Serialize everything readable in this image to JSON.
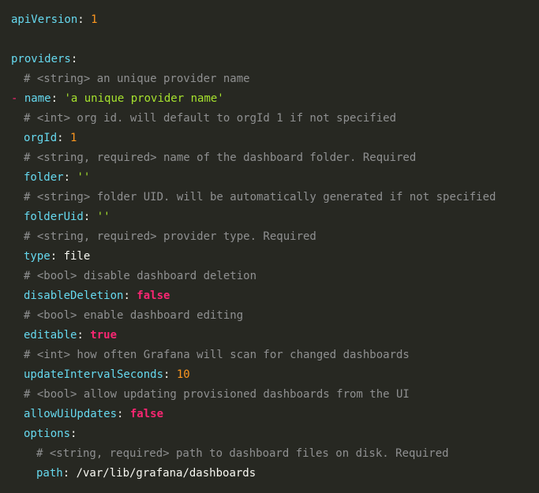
{
  "editor": {
    "background": "#272822",
    "colors": {
      "key": "#66d9ef",
      "number": "#fd971f",
      "string": "#a6e22e",
      "boolean": "#f92672",
      "comment": "#8f9091",
      "text": "#f8f8f2"
    },
    "lines": {
      "l1_key": "apiVersion",
      "l1_val": "1",
      "l3_key": "providers",
      "l4_comment": "# <string> an unique provider name",
      "l5_dash": "- ",
      "l5_key": "name",
      "l5_val": "'a unique provider name'",
      "l6_comment": "# <int> org id. will default to orgId 1 if not specified",
      "l7_key": "orgId",
      "l7_val": "1",
      "l8_comment": "# <string, required> name of the dashboard folder. Required",
      "l9_key": "folder",
      "l9_val": "''",
      "l10_comment": "# <string> folder UID. will be automatically generated if not specified",
      "l11_key": "folderUid",
      "l11_val": "''",
      "l12_comment": "# <string, required> provider type. Required",
      "l13_key": "type",
      "l13_val": "file",
      "l14_comment": "# <bool> disable dashboard deletion",
      "l15_key": "disableDeletion",
      "l15_val": "false",
      "l16_comment": "# <bool> enable dashboard editing",
      "l17_key": "editable",
      "l17_val": "true",
      "l18_comment": "# <int> how often Grafana will scan for changed dashboards",
      "l19_key": "updateIntervalSeconds",
      "l19_val": "10",
      "l20_comment": "# <bool> allow updating provisioned dashboards from the UI",
      "l21_key": "allowUiUpdates",
      "l21_val": "false",
      "l22_key": "options",
      "l23_comment": "# <string, required> path to dashboard files on disk. Required",
      "l24_key": "path",
      "l24_val": "/var/lib/grafana/dashboards"
    }
  }
}
